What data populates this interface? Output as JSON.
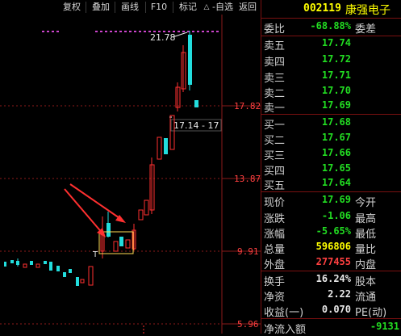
{
  "toolbar": {
    "items": [
      "复权",
      "叠加",
      "画线",
      "F10",
      "标记",
      "-自选",
      "返回"
    ],
    "up_arrow": "△"
  },
  "chart": {
    "price_levels": [
      "17.82",
      "13.87",
      "9.91",
      "5.96"
    ],
    "high_label": "21.78",
    "cursor_label": "17.14 - 17",
    "marker_T": "T"
  },
  "quote": {
    "code": "002119",
    "name": "康强电子",
    "weibi": {
      "label": "委比",
      "value": "-68.88%",
      "label2": "委差"
    },
    "sell": [
      {
        "label": "卖五",
        "price": "17.74"
      },
      {
        "label": "卖四",
        "price": "17.72"
      },
      {
        "label": "卖三",
        "price": "17.71"
      },
      {
        "label": "卖二",
        "price": "17.70"
      },
      {
        "label": "卖一",
        "price": "17.69"
      }
    ],
    "buy": [
      {
        "label": "买一",
        "price": "17.68"
      },
      {
        "label": "买二",
        "price": "17.67"
      },
      {
        "label": "买三",
        "price": "17.66"
      },
      {
        "label": "买四",
        "price": "17.65"
      },
      {
        "label": "买五",
        "price": "17.64"
      }
    ],
    "stats": [
      {
        "label": "现价",
        "value": "17.69",
        "label2": "今开"
      },
      {
        "label": "涨跌",
        "value": "-1.06",
        "label2": "最高"
      },
      {
        "label": "涨幅",
        "value": "-5.65%",
        "label2": "最低"
      },
      {
        "label": "总量",
        "value": "596806",
        "label2": "量比"
      },
      {
        "label": "外盘",
        "value": "277455",
        "label2": "内盘"
      }
    ],
    "fin": [
      {
        "label": "换手",
        "value": "16.24%",
        "label2": "股本"
      },
      {
        "label": "净资",
        "value": "2.22",
        "label2": "流通"
      },
      {
        "label": "收益(一)",
        "value": "0.070",
        "label2": "PE(动)"
      }
    ],
    "netflow": {
      "label": "净流入额",
      "value": "-9131"
    }
  },
  "colors": {
    "up": "#ff3030",
    "down": "#22dddd",
    "grid": "#8b1a1a",
    "text": "#d0d0d0"
  }
}
